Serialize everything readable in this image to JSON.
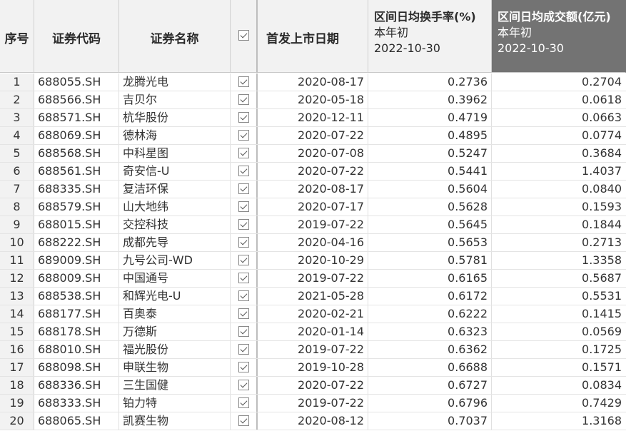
{
  "headers": {
    "index": "序号",
    "code": "证券代码",
    "name": "证券名称",
    "list_date": "首发上市日期",
    "turnover": {
      "title": "区间日均换手率(%)",
      "sub1": "本年初",
      "sub2": "2022-10-30"
    },
    "amount": {
      "title": "区间日均成交额(亿元)",
      "sub1": "本年初",
      "sub2": "2022-10-30"
    }
  },
  "rows": [
    {
      "idx": "1",
      "code": "688055.SH",
      "name": "龙腾光电",
      "date": "2020-08-17",
      "turnover": "0.2736",
      "amount": "0.2704"
    },
    {
      "idx": "2",
      "code": "688566.SH",
      "name": "吉贝尔",
      "date": "2020-05-18",
      "turnover": "0.3962",
      "amount": "0.0618"
    },
    {
      "idx": "3",
      "code": "688571.SH",
      "name": "杭华股份",
      "date": "2020-12-11",
      "turnover": "0.4719",
      "amount": "0.0663"
    },
    {
      "idx": "4",
      "code": "688069.SH",
      "name": "德林海",
      "date": "2020-07-22",
      "turnover": "0.4895",
      "amount": "0.0774"
    },
    {
      "idx": "5",
      "code": "688568.SH",
      "name": "中科星图",
      "date": "2020-07-08",
      "turnover": "0.5247",
      "amount": "0.3684"
    },
    {
      "idx": "6",
      "code": "688561.SH",
      "name": "奇安信-U",
      "date": "2020-07-22",
      "turnover": "0.5441",
      "amount": "1.4037"
    },
    {
      "idx": "7",
      "code": "688335.SH",
      "name": "复洁环保",
      "date": "2020-08-17",
      "turnover": "0.5604",
      "amount": "0.0840"
    },
    {
      "idx": "8",
      "code": "688579.SH",
      "name": "山大地纬",
      "date": "2020-07-17",
      "turnover": "0.5628",
      "amount": "0.1593"
    },
    {
      "idx": "9",
      "code": "688015.SH",
      "name": "交控科技",
      "date": "2019-07-22",
      "turnover": "0.5645",
      "amount": "0.1844"
    },
    {
      "idx": "10",
      "code": "688222.SH",
      "name": "成都先导",
      "date": "2020-04-16",
      "turnover": "0.5653",
      "amount": "0.2713"
    },
    {
      "idx": "11",
      "code": "689009.SH",
      "name": "九号公司-WD",
      "date": "2020-10-29",
      "turnover": "0.5781",
      "amount": "1.3358"
    },
    {
      "idx": "12",
      "code": "688009.SH",
      "name": "中国通号",
      "date": "2019-07-22",
      "turnover": "0.6165",
      "amount": "0.5687"
    },
    {
      "idx": "13",
      "code": "688538.SH",
      "name": "和辉光电-U",
      "date": "2021-05-28",
      "turnover": "0.6172",
      "amount": "0.5531"
    },
    {
      "idx": "14",
      "code": "688177.SH",
      "name": "百奥泰",
      "date": "2020-02-21",
      "turnover": "0.6222",
      "amount": "0.1415"
    },
    {
      "idx": "15",
      "code": "688178.SH",
      "name": "万德斯",
      "date": "2020-01-14",
      "turnover": "0.6323",
      "amount": "0.0569"
    },
    {
      "idx": "16",
      "code": "688010.SH",
      "name": "福光股份",
      "date": "2019-07-22",
      "turnover": "0.6362",
      "amount": "0.1725"
    },
    {
      "idx": "17",
      "code": "688098.SH",
      "name": "申联生物",
      "date": "2019-10-28",
      "turnover": "0.6688",
      "amount": "0.1571"
    },
    {
      "idx": "18",
      "code": "688336.SH",
      "name": "三生国健",
      "date": "2020-07-22",
      "turnover": "0.6727",
      "amount": "0.0834"
    },
    {
      "idx": "19",
      "code": "688333.SH",
      "name": "铂力特",
      "date": "2019-07-22",
      "turnover": "0.6796",
      "amount": "0.7429"
    },
    {
      "idx": "20",
      "code": "688065.SH",
      "name": "凯赛生物",
      "date": "2020-08-12",
      "turnover": "0.7037",
      "amount": "1.3168"
    }
  ]
}
